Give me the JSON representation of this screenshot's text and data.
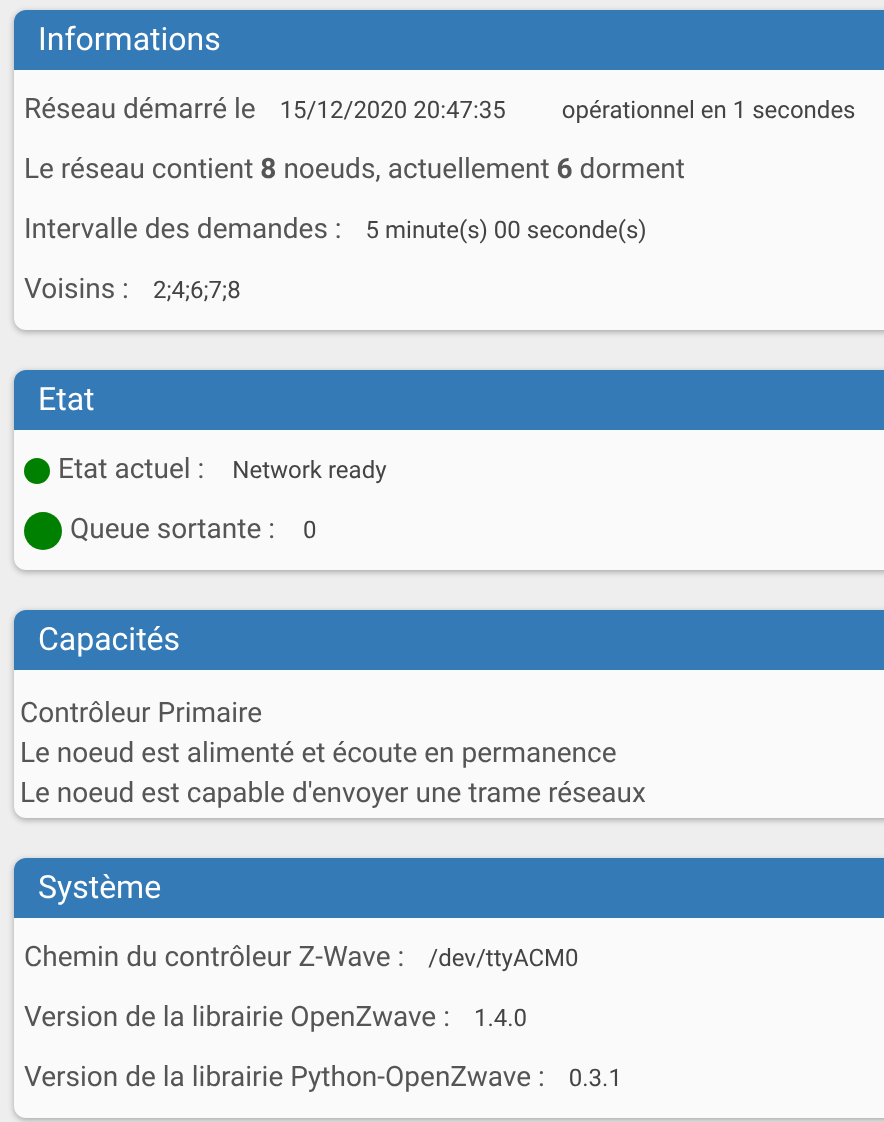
{
  "sections": [
    {
      "title": "Informations",
      "rows": [
        {
          "kind": "field",
          "label": "Réseau démarré le",
          "value": "15/12/2020 20:47:35",
          "extra": "opérationnel en 1 secondes"
        },
        {
          "kind": "sentence",
          "text": "Le réseau contient **8** noeuds, actuellement **6** dorment"
        },
        {
          "kind": "field",
          "label": "Intervalle des demandes :",
          "value": "5 minute(s) 00 seconde(s)"
        },
        {
          "kind": "field",
          "label": "Voisins :",
          "value": "2;4;6;7;8"
        }
      ]
    },
    {
      "title": "Etat",
      "rows": [
        {
          "kind": "status",
          "label": "Etat actuel :",
          "value": "Network ready",
          "color": "#008000"
        },
        {
          "kind": "status",
          "label": "Queue sortante :",
          "value": "0",
          "color": "#008000"
        }
      ]
    },
    {
      "title": "Capacités",
      "rows": [
        {
          "kind": "bullet",
          "text": "Contrôleur Primaire"
        },
        {
          "kind": "bullet",
          "text": "Le noeud est alimenté et écoute en permanence"
        },
        {
          "kind": "bullet",
          "text": "Le noeud est capable d'envoyer une trame réseaux"
        }
      ]
    },
    {
      "title": "Système",
      "rows": [
        {
          "kind": "field",
          "label": "Chemin du contrôleur Z-Wave :",
          "value": "/dev/ttyACM0"
        },
        {
          "kind": "field",
          "label": "Version de la librairie OpenZwave :",
          "value": "1.4.0"
        },
        {
          "kind": "field",
          "label": "Version de la librairie Python-OpenZwave :",
          "value": "0.3.1"
        }
      ]
    }
  ]
}
